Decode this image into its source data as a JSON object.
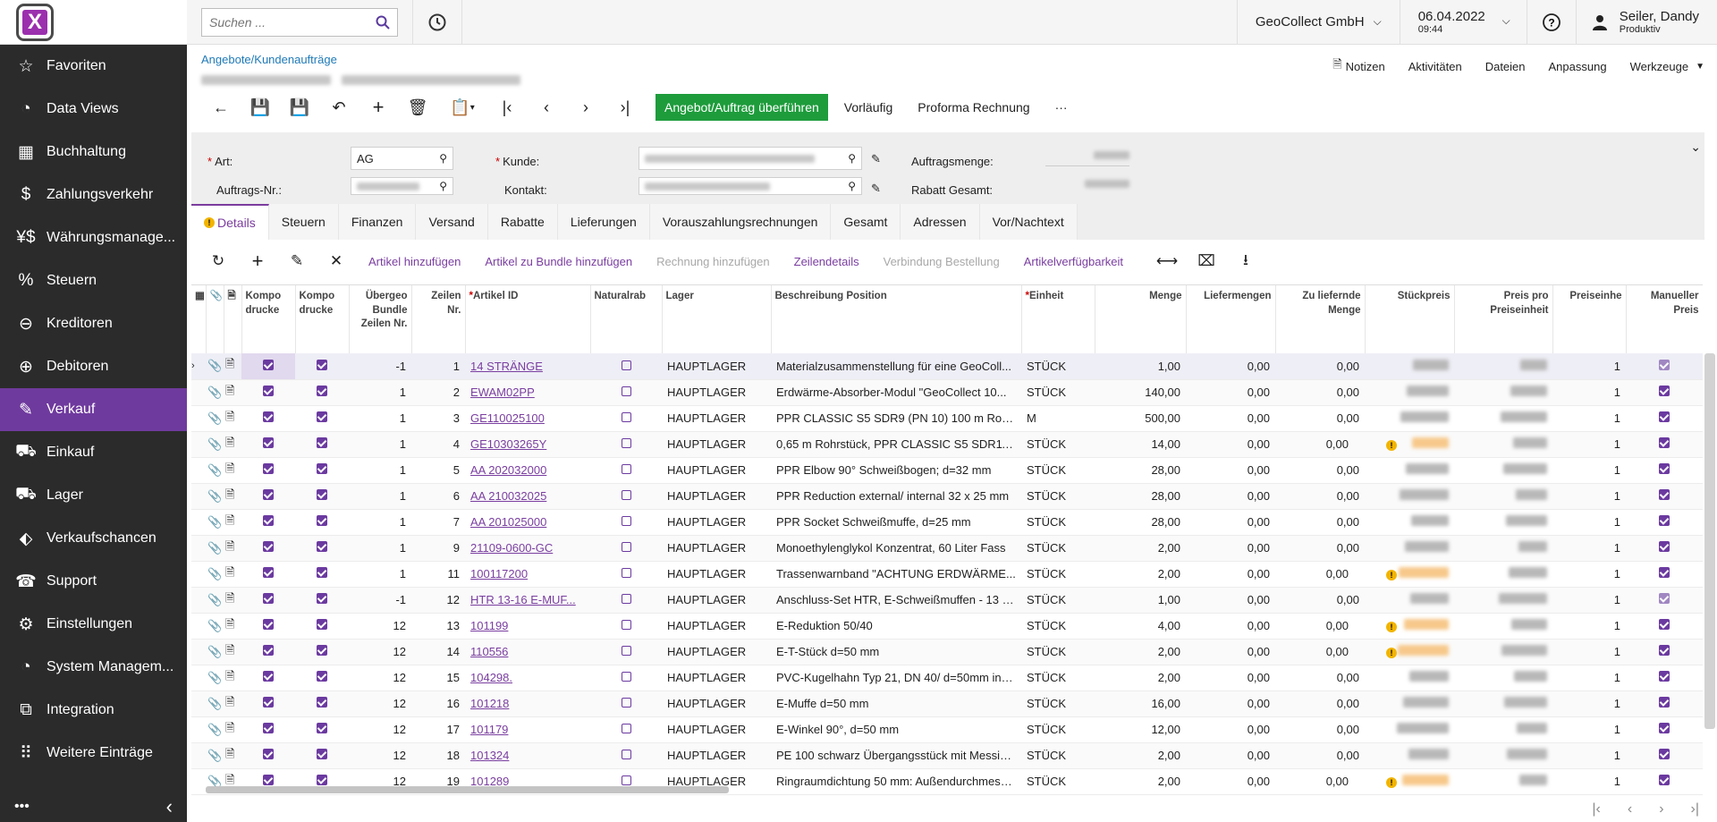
{
  "logo_letter": "X",
  "sidebar": {
    "items": [
      {
        "icon": "star-icon",
        "glyph": "☆",
        "label": "Favoriten"
      },
      {
        "icon": "pie-chart-icon",
        "glyph": "◔",
        "label": "Data Views"
      },
      {
        "icon": "calculator-icon",
        "glyph": "▦",
        "label": "Buchhaltung"
      },
      {
        "icon": "dollar-icon",
        "glyph": "$",
        "label": "Zahlungsverkehr"
      },
      {
        "icon": "currency-icon",
        "glyph": "¥$",
        "label": "Währungsmanage..."
      },
      {
        "icon": "percent-icon",
        "glyph": "%",
        "label": "Steuern"
      },
      {
        "icon": "minus-circle-icon",
        "glyph": "⊖",
        "label": "Kreditoren"
      },
      {
        "icon": "plus-circle-icon",
        "glyph": "⊕",
        "label": "Debitoren"
      },
      {
        "icon": "edit-icon",
        "glyph": "✎",
        "label": "Verkauf"
      },
      {
        "icon": "cart-icon",
        "glyph": "⛟",
        "label": "Einkauf"
      },
      {
        "icon": "truck-icon",
        "glyph": "⛟",
        "label": "Lager"
      },
      {
        "icon": "tag-icon",
        "glyph": "⬖",
        "label": "Verkaufschancen"
      },
      {
        "icon": "support-icon",
        "glyph": "☎",
        "label": "Support"
      },
      {
        "icon": "gear-icon",
        "glyph": "⚙",
        "label": "Einstellungen"
      },
      {
        "icon": "system-icon",
        "glyph": "◔",
        "label": "System Managem..."
      },
      {
        "icon": "integration-icon",
        "glyph": "⧉",
        "label": "Integration"
      },
      {
        "icon": "grid-icon",
        "glyph": "⠿",
        "label": "Weitere Einträge"
      }
    ],
    "active_index": 8,
    "bottom_more": "•••",
    "bottom_collapse": "‹"
  },
  "topbar": {
    "search_placeholder": "Suchen ...",
    "company": "GeoCollect GmbH",
    "date": "06.04.2022",
    "time": "09:44",
    "user_name": "Seiler, Dandy",
    "user_role": "Produktiv"
  },
  "header": {
    "breadcrumb": "Angebote/Kundenaufträge",
    "links": [
      "Notizen",
      "Aktivitäten",
      "Dateien",
      "Anpassung",
      "Werkzeuge"
    ],
    "primary_action": "Angebot/Auftrag überführen",
    "actions": [
      "Vorläufig",
      "Proforma Rechnung"
    ],
    "more": "···"
  },
  "form": {
    "art_label": "Art:",
    "art_value": "AG",
    "auftrags_label": "Auftrags-Nr.:",
    "kunde_label": "Kunde:",
    "kontakt_label": "Kontakt:",
    "auftragsmenge_label": "Auftragsmenge:",
    "rabatt_label": "Rabatt Gesamt:"
  },
  "tabs": [
    "Details",
    "Steuern",
    "Finanzen",
    "Versand",
    "Rabatte",
    "Lieferungen",
    "Vorauszahlungsrechnungen",
    "Gesamt",
    "Adressen",
    "Vor/Nachtext"
  ],
  "grid_toolbar": {
    "links": [
      {
        "label": "Artikel hinzufügen",
        "enabled": true
      },
      {
        "label": "Artikel zu Bundle hinzufügen",
        "enabled": true
      },
      {
        "label": "Rechnung hinzufügen",
        "enabled": false
      },
      {
        "label": "Zeilendetails",
        "enabled": true
      },
      {
        "label": "Verbindung Bestellung",
        "enabled": false
      },
      {
        "label": "Artikelverfügbarkeit",
        "enabled": true
      }
    ]
  },
  "columns": {
    "komp1": "Kompo drucke",
    "komp2": "Kompo drucke",
    "bundle": "Übergeo Bundle Zeilen Nr.",
    "zeilen": "Zeilen Nr.",
    "artikel": "Artikel ID",
    "natural": "Naturalrab",
    "lager": "Lager",
    "beschreibung": "Beschreibung Position",
    "einheit": "Einheit",
    "menge": "Menge",
    "liefermengen": "Liefermengen",
    "zuliefernde": "Zu liefernde Menge",
    "stueckpreis": "Stückpreis",
    "preis_pro": "Preis pro Preiseinheit",
    "preiseinheit": "Preiseinhe",
    "manueller": "Manueller Preis"
  },
  "rows": [
    {
      "bundle": "-1",
      "zeile": "1",
      "artikel": "14 STRÄNGE",
      "lager": "HAUPTLAGER",
      "beschreibung": "Materialzusammenstellung für eine GeoColl...",
      "einheit": "STÜCK",
      "menge": "1,00",
      "liefer": "0,00",
      "zuliefer": "0,00",
      "warn": false,
      "pe": "1",
      "manual_light": true
    },
    {
      "bundle": "1",
      "zeile": "2",
      "artikel": "EWAM02PP",
      "lager": "HAUPTLAGER",
      "beschreibung": "Erdwärme-Absorber-Modul \"GeoCollect 10...",
      "einheit": "STÜCK",
      "menge": "140,00",
      "liefer": "0,00",
      "zuliefer": "0,00",
      "warn": false,
      "pe": "1",
      "manual_light": false
    },
    {
      "bundle": "1",
      "zeile": "3",
      "artikel": "GE110025100",
      "lager": "HAUPTLAGER",
      "beschreibung": "PPR CLASSIC S5 SDR9 (PN 10) 100 m Rohr i...",
      "einheit": "M",
      "menge": "500,00",
      "liefer": "0,00",
      "zuliefer": "0,00",
      "warn": false,
      "pe": "1",
      "manual_light": false
    },
    {
      "bundle": "1",
      "zeile": "4",
      "artikel": "GE10303265Y",
      "lager": "HAUPTLAGER",
      "beschreibung": "0,65 m Rohrstück, PPR CLASSIC S5 SDR11 (...",
      "einheit": "STÜCK",
      "menge": "14,00",
      "liefer": "0,00",
      "zuliefer": "0,00",
      "warn": true,
      "pe": "1",
      "manual_light": false
    },
    {
      "bundle": "1",
      "zeile": "5",
      "artikel": "AA 202032000",
      "lager": "HAUPTLAGER",
      "beschreibung": "PPR Elbow 90° Schweißbogen; d=32 mm",
      "einheit": "STÜCK",
      "menge": "28,00",
      "liefer": "0,00",
      "zuliefer": "0,00",
      "warn": false,
      "pe": "1",
      "manual_light": false
    },
    {
      "bundle": "1",
      "zeile": "6",
      "artikel": "AA 210032025",
      "lager": "HAUPTLAGER",
      "beschreibung": "PPR Reduction external/ internal 32 x 25 mm",
      "einheit": "STÜCK",
      "menge": "28,00",
      "liefer": "0,00",
      "zuliefer": "0,00",
      "warn": false,
      "pe": "1",
      "manual_light": false
    },
    {
      "bundle": "1",
      "zeile": "7",
      "artikel": "AA 201025000",
      "lager": "HAUPTLAGER",
      "beschreibung": "PPR Socket Schweißmuffe, d=25 mm",
      "einheit": "STÜCK",
      "menge": "28,00",
      "liefer": "0,00",
      "zuliefer": "0,00",
      "warn": false,
      "pe": "1",
      "manual_light": false
    },
    {
      "bundle": "1",
      "zeile": "9",
      "artikel": "21109-0600-GC",
      "lager": "HAUPTLAGER",
      "beschreibung": "Monoethylenglykol Konzentrat, 60 Liter Fass",
      "einheit": "STÜCK",
      "menge": "2,00",
      "liefer": "0,00",
      "zuliefer": "0,00",
      "warn": false,
      "pe": "1",
      "manual_light": false
    },
    {
      "bundle": "1",
      "zeile": "11",
      "artikel": "100117200",
      "lager": "HAUPTLAGER",
      "beschreibung": "Trassenwarnband \"ACHTUNG ERDWÄRME...",
      "einheit": "STÜCK",
      "menge": "2,00",
      "liefer": "0,00",
      "zuliefer": "0,00",
      "warn": true,
      "pe": "1",
      "manual_light": false
    },
    {
      "bundle": "-1",
      "zeile": "12",
      "artikel": "HTR 13-16 E-MUF...",
      "lager": "HAUPTLAGER",
      "beschreibung": "Anschluss-Set HTR, E-Schweißmuffen - 13 bi...",
      "einheit": "STÜCK",
      "menge": "1,00",
      "liefer": "0,00",
      "zuliefer": "0,00",
      "warn": false,
      "pe": "1",
      "manual_light": true
    },
    {
      "bundle": "12",
      "zeile": "13",
      "artikel": "101199",
      "lager": "HAUPTLAGER",
      "beschreibung": "E-Reduktion 50/40",
      "einheit": "STÜCK",
      "menge": "4,00",
      "liefer": "0,00",
      "zuliefer": "0,00",
      "warn": true,
      "pe": "1",
      "manual_light": false
    },
    {
      "bundle": "12",
      "zeile": "14",
      "artikel": "110556",
      "lager": "HAUPTLAGER",
      "beschreibung": "E-T-Stück d=50 mm",
      "einheit": "STÜCK",
      "menge": "2,00",
      "liefer": "0,00",
      "zuliefer": "0,00",
      "warn": true,
      "pe": "1",
      "manual_light": false
    },
    {
      "bundle": "12",
      "zeile": "15",
      "artikel": "104298.",
      "lager": "HAUPTLAGER",
      "beschreibung": "PVC-Kugelhahn Typ 21, DN 40/ d=50mm ink...",
      "einheit": "STÜCK",
      "menge": "2,00",
      "liefer": "0,00",
      "zuliefer": "0,00",
      "warn": false,
      "pe": "1",
      "manual_light": false
    },
    {
      "bundle": "12",
      "zeile": "16",
      "artikel": "101218",
      "lager": "HAUPTLAGER",
      "beschreibung": "E-Muffe d=50 mm",
      "einheit": "STÜCK",
      "menge": "16,00",
      "liefer": "0,00",
      "zuliefer": "0,00",
      "warn": false,
      "pe": "1",
      "manual_light": false
    },
    {
      "bundle": "12",
      "zeile": "17",
      "artikel": "101179",
      "lager": "HAUPTLAGER",
      "beschreibung": "E-Winkel 90°, d=50 mm",
      "einheit": "STÜCK",
      "menge": "12,00",
      "liefer": "0,00",
      "zuliefer": "0,00",
      "warn": false,
      "pe": "1",
      "manual_light": false
    },
    {
      "bundle": "12",
      "zeile": "18",
      "artikel": "101324",
      "lager": "HAUPTLAGER",
      "beschreibung": "PE 100 schwarz Übergangsstück mit Messin...",
      "einheit": "STÜCK",
      "menge": "2,00",
      "liefer": "0,00",
      "zuliefer": "0,00",
      "warn": false,
      "pe": "1",
      "manual_light": false
    },
    {
      "bundle": "12",
      "zeile": "19",
      "artikel": "101289",
      "lager": "HAUPTLAGER",
      "beschreibung": "Ringraumdichtung 50 mm: Außendurchmess...",
      "einheit": "STÜCK",
      "menge": "2,00",
      "liefer": "0,00",
      "zuliefer": "0,00",
      "warn": true,
      "pe": "1",
      "manual_light": false
    }
  ],
  "colors": {
    "sidebar": "#2b2b2b",
    "active": "#6f3a9e",
    "accent": "#7a3ea0",
    "primary_button": "#1e9c3c",
    "warning": "#f2b400"
  }
}
